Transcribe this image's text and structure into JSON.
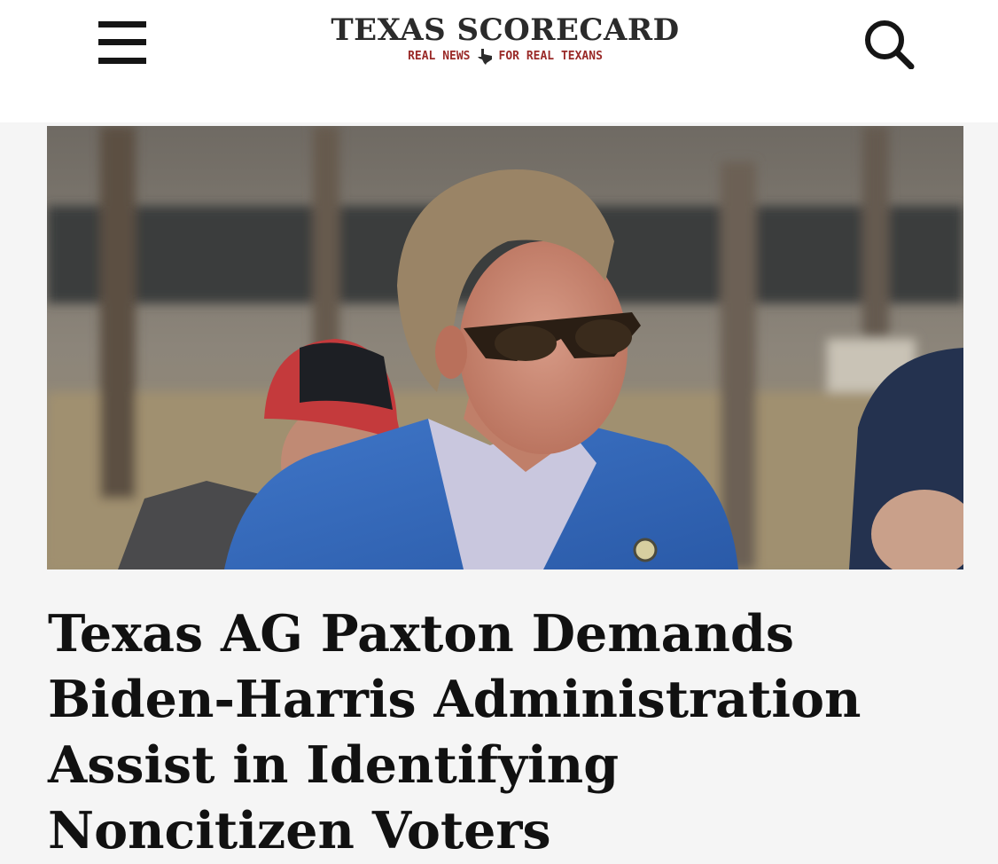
{
  "header": {
    "logo_title": "TEXAS SCORECARD",
    "logo_tagline_left": "REAL NEWS",
    "logo_tagline_right": "FOR REAL TEXANS",
    "menu_icon": "hamburger-menu-icon",
    "search_icon": "search-icon"
  },
  "article": {
    "headline": "Texas AG Paxton Demands Biden-Harris Administration Assist in Identifying Noncitizen Voters"
  },
  "colors": {
    "brand_dark": "#2b2b2b",
    "brand_red": "#9a2a28",
    "page_bg": "#f5f5f5",
    "header_bg": "#ffffff"
  }
}
